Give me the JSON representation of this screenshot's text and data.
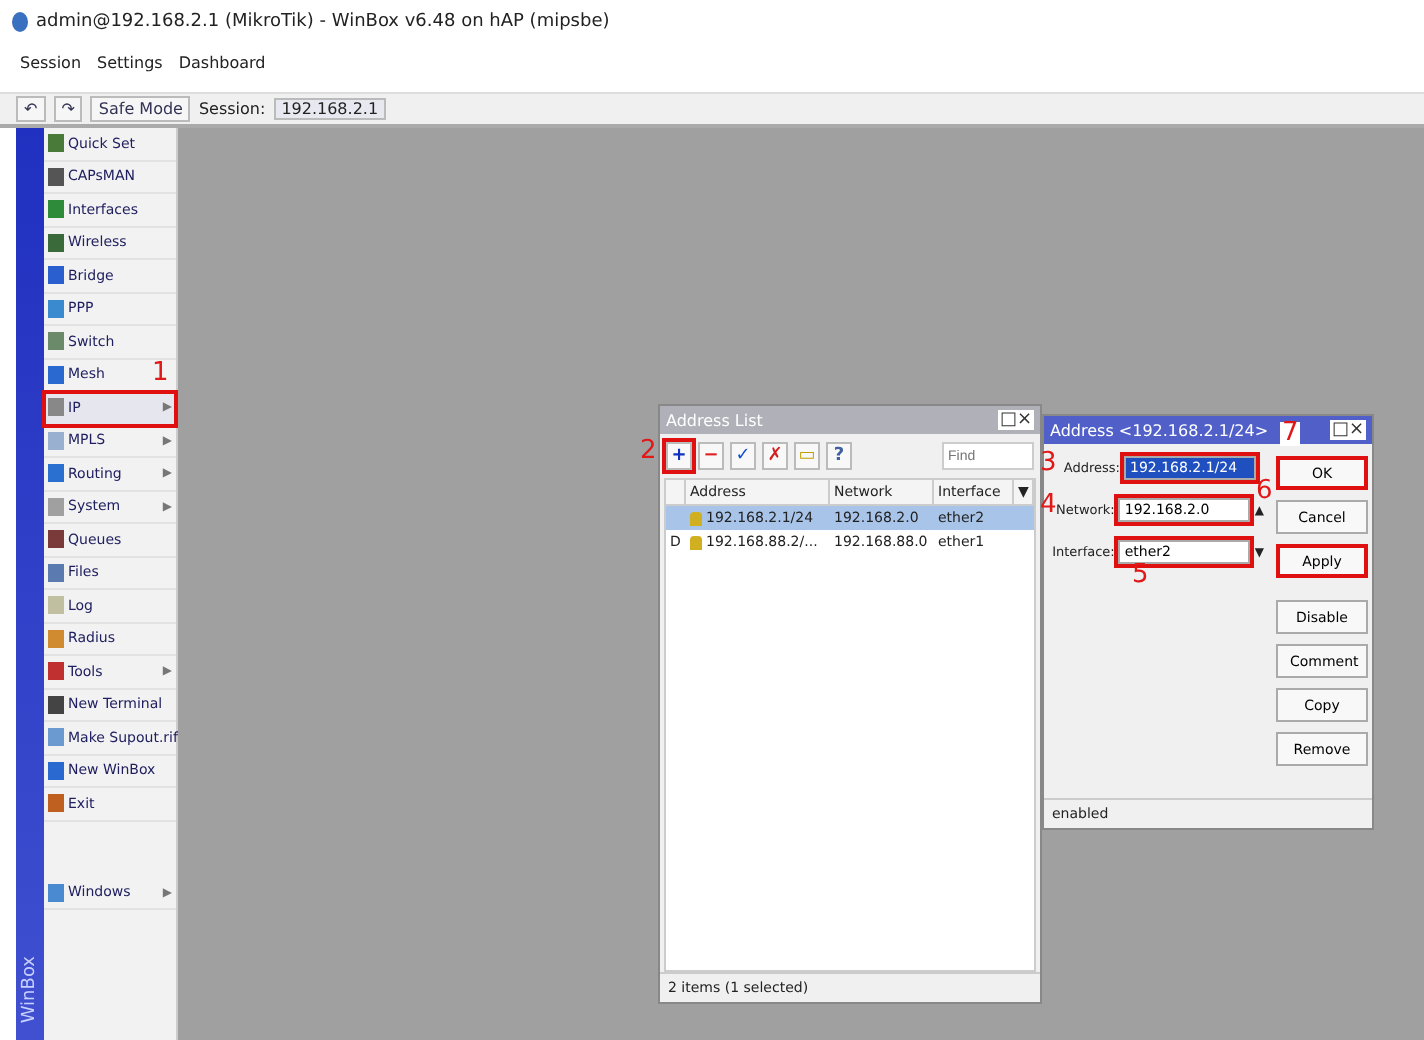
{
  "window": {
    "title": "admin@192.168.2.1 (MikroTik) - WinBox v6.48 on hAP (mipsbe)"
  },
  "menu": [
    "Session",
    "Settings",
    "Dashboard"
  ],
  "toolbar": {
    "undo": "↶",
    "redo": "↷",
    "safe_mode": "Safe Mode",
    "session_label": "Session:",
    "session_value": "192.168.2.1"
  },
  "sidebar": {
    "brand": "WinBox",
    "items": [
      {
        "label": "Quick Set",
        "selected": false,
        "color": "#4a7a3a"
      },
      {
        "label": "CAPsMAN",
        "selected": false,
        "color": "#555555"
      },
      {
        "label": "Interfaces",
        "selected": false,
        "color": "#2e8b3a"
      },
      {
        "label": "Wireless",
        "selected": false,
        "color": "#3a6a3a"
      },
      {
        "label": "Bridge",
        "selected": false,
        "color": "#2a5fd0"
      },
      {
        "label": "PPP",
        "selected": false,
        "color": "#3a8ad0"
      },
      {
        "label": "Switch",
        "selected": false,
        "color": "#6a8a6a"
      },
      {
        "label": "Mesh",
        "selected": false,
        "color": "#2a6ad0"
      },
      {
        "label": "IP",
        "arrow": "▶",
        "selected": true,
        "color": "#888888",
        "callout": "1"
      },
      {
        "label": "MPLS",
        "arrow": "▶",
        "selected": false,
        "color": "#9ab0d0"
      },
      {
        "label": "Routing",
        "arrow": "▶",
        "selected": false,
        "color": "#2a70d0"
      },
      {
        "label": "System",
        "arrow": "▶",
        "selected": false,
        "color": "#a0a0a0"
      },
      {
        "label": "Queues",
        "selected": false,
        "color": "#7a3a3a"
      },
      {
        "label": "Files",
        "selected": false,
        "color": "#5a7ab0"
      },
      {
        "label": "Log",
        "selected": false,
        "color": "#c0c0a0"
      },
      {
        "label": "Radius",
        "selected": false,
        "color": "#d08a30"
      },
      {
        "label": "Tools",
        "arrow": "▶",
        "selected": false,
        "color": "#c03030"
      },
      {
        "label": "New Terminal",
        "selected": false,
        "color": "#444444"
      },
      {
        "label": "Make Supout.rif",
        "selected": false,
        "color": "#6a9ad0"
      },
      {
        "label": "New WinBox",
        "selected": false,
        "color": "#2a6ad0"
      },
      {
        "label": "Exit",
        "selected": false,
        "color": "#c06020"
      }
    ],
    "footer_items": [
      {
        "label": "Windows",
        "arrow": "▶",
        "selected": false,
        "color": "#4a8ad0"
      }
    ]
  },
  "address_list": {
    "title": "Address List",
    "controls": "□×",
    "tools": [
      {
        "kind": "add",
        "label": "+",
        "highlighted": true,
        "callout": "2"
      },
      {
        "kind": "remove",
        "label": "−",
        "highlighted": false
      },
      {
        "kind": "enable",
        "label": "✓",
        "highlighted": false
      },
      {
        "kind": "disable",
        "label": "✗",
        "highlighted": false
      },
      {
        "kind": "comment",
        "label": "▭",
        "highlighted": false
      },
      {
        "kind": "filter",
        "label": "?",
        "highlighted": false
      }
    ],
    "find": {
      "placeholder": "Find"
    },
    "columns": [
      "Address",
      "Network",
      "Interface"
    ],
    "column_menu": "▼",
    "rows": [
      {
        "flag": "",
        "address": "192.168.2.1/24",
        "network": "192.168.2.0",
        "interface": "ether2",
        "selected": true
      },
      {
        "flag": "D",
        "address": "192.168.88.2/...",
        "network": "192.168.88.0",
        "interface": "ether1",
        "selected": false
      }
    ],
    "status": "2 items (1 selected)"
  },
  "address_dialog": {
    "title": "Address <192.168.2.1/24>",
    "controls": "□×",
    "fields": [
      {
        "label": "Address:",
        "value": "192.168.2.1/24",
        "highlighted": true,
        "callout": "3"
      },
      {
        "label": "Network:",
        "value": "192.168.2.0",
        "highlighted": true,
        "callout": "4",
        "suffix": "▲"
      },
      {
        "label": "Interface:",
        "value": "ether2",
        "highlighted": true,
        "callout": "5",
        "suffix": "▼"
      }
    ],
    "buttons": [
      {
        "label": "OK",
        "highlighted": true,
        "callout": "7"
      },
      {
        "label": "Cancel",
        "highlighted": false,
        "callout": "6"
      },
      {
        "label": "Apply",
        "highlighted": true
      },
      {
        "label": "Disable",
        "highlighted": false
      },
      {
        "label": "Comment",
        "highlighted": false
      },
      {
        "label": "Copy",
        "highlighted": false
      },
      {
        "label": "Remove",
        "highlighted": false
      }
    ],
    "status": "enabled"
  }
}
